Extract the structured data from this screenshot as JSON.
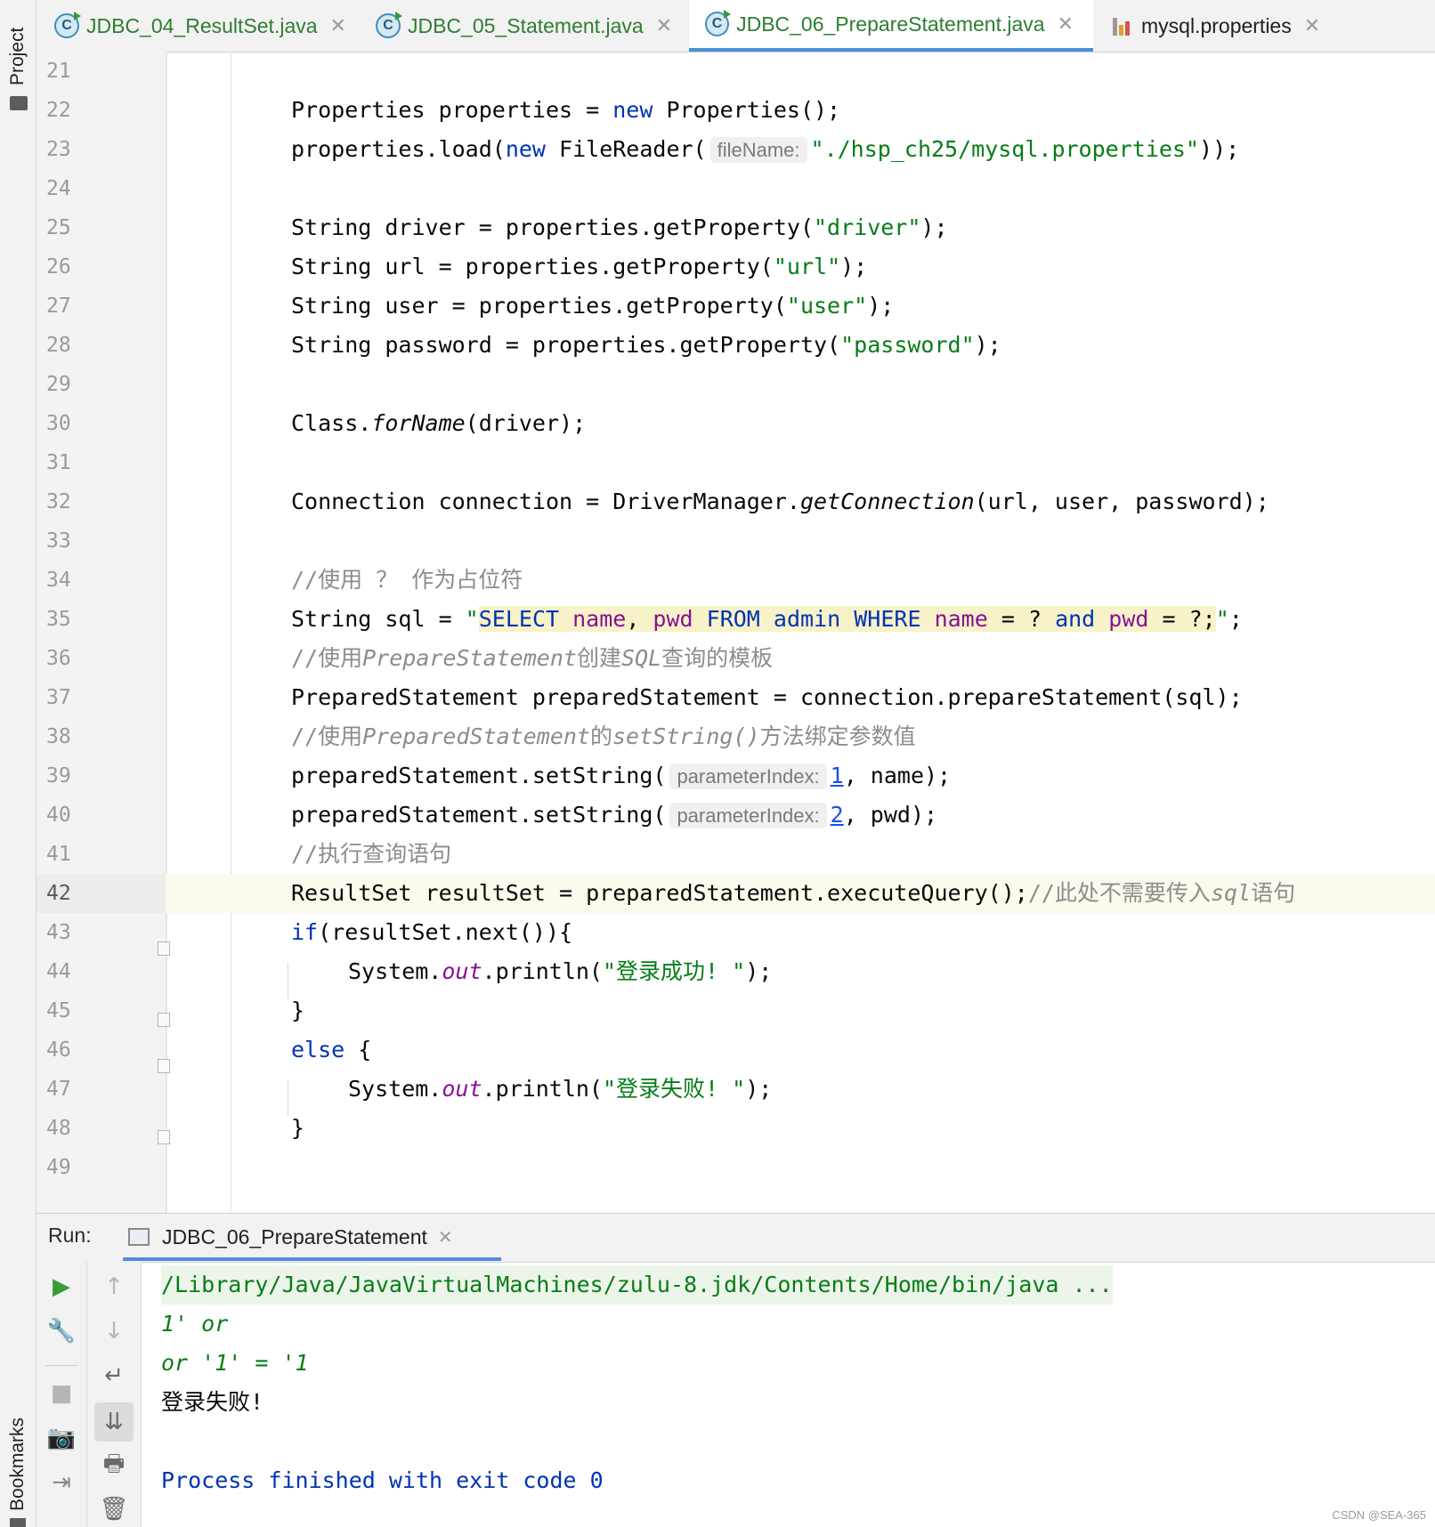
{
  "sidebar": {
    "project_label": "Project",
    "bookmarks_label": "Bookmarks"
  },
  "tabs": [
    {
      "label": "JDBC_04_ResultSet.java",
      "icon": "java-class-icon",
      "active": false
    },
    {
      "label": "JDBC_05_Statement.java",
      "icon": "java-class-icon",
      "active": false
    },
    {
      "label": "JDBC_06_PrepareStatement.java",
      "icon": "java-class-icon",
      "active": true
    },
    {
      "label": "mysql.properties",
      "icon": "properties-file-icon",
      "active": false
    }
  ],
  "editor": {
    "line_numbers": [
      "21",
      "22",
      "23",
      "24",
      "25",
      "26",
      "27",
      "28",
      "29",
      "30",
      "31",
      "32",
      "33",
      "34",
      "35",
      "36",
      "37",
      "38",
      "39",
      "40",
      "41",
      "42",
      "43",
      "44",
      "45",
      "46",
      "47",
      "48",
      "49"
    ],
    "current_line": "42",
    "hints": {
      "file_name": "fileName:",
      "parameter_index": "parameterIndex:"
    },
    "lines": {
      "l22": {
        "t1": "Properties properties = ",
        "kw": "new",
        "t2": " Properties();"
      },
      "l23": {
        "t1": "properties.load(",
        "kw": "new",
        "t2": " FileReader(",
        "s": "\"./hsp_ch25/mysql.properties\"",
        "t3": "));"
      },
      "l25": {
        "t1": "String driver = properties.getProperty(",
        "s": "\"driver\"",
        "t2": ");"
      },
      "l26": {
        "t1": "String url = properties.getProperty(",
        "s": "\"url\"",
        "t2": ");"
      },
      "l27": {
        "t1": "String user = properties.getProperty(",
        "s": "\"user\"",
        "t2": ");"
      },
      "l28": {
        "t1": "String password = properties.getProperty(",
        "s": "\"password\"",
        "t2": ");"
      },
      "l30": {
        "t1": "Class.",
        "it": "forName",
        "t2": "(driver);"
      },
      "l32": {
        "t1": "Connection connection = DriverManager.",
        "it": "getConnection",
        "t2": "(url, user, password);"
      },
      "l34": {
        "c": "//使用 ？ 作为占位符"
      },
      "l35": {
        "t1": "String sql = ",
        "q1": "\"",
        "k1": "SELECT",
        "i1": " name",
        "p1": ", ",
        "i2": "pwd",
        "sp1": " ",
        "k2": "FROM",
        "sp2": " ",
        "k3": "admin",
        "sp3": " ",
        "k4": "WHERE",
        "sp4": " ",
        "i3": "name",
        "p2": " = ? ",
        "k5": "and",
        "sp5": " ",
        "i4": "pwd",
        "p3": " = ?;",
        "q2": "\"",
        "t2": ";"
      },
      "l36": {
        "c1": "//使用",
        "ci1": "PrepareStatement",
        "c2": "创建",
        "ci2": "SQL",
        "c3": "查询的模板"
      },
      "l37": {
        "t1": "PreparedStatement preparedStatement = connection.prepareStatement(sql);"
      },
      "l38": {
        "c1": "//使用",
        "ci1": "PreparedStatement",
        "c2": "的",
        "ci2": "setString()",
        "c3": "方法绑定参数值"
      },
      "l39": {
        "t1": "preparedStatement.setString(",
        "n": "1",
        "t2": ", name);"
      },
      "l40": {
        "t1": "preparedStatement.setString(",
        "n": "2",
        "t2": ", pwd);"
      },
      "l41": {
        "c": "//执行查询语句"
      },
      "l42": {
        "t1": "ResultSet resultSet = preparedStatement.executeQuery();",
        "c1": "//此处不需要传入",
        "ci1": "sql",
        "c2": "语句"
      },
      "l43": {
        "kw": "if",
        "t1": "(resultSet.next()){"
      },
      "l44": {
        "t1": "System.",
        "f": "out",
        "t2": ".println(",
        "s": "\"登录成功! \"",
        "t3": ");"
      },
      "l45": {
        "t1": "}"
      },
      "l46": {
        "kw": "else",
        "t1": " {"
      },
      "l47": {
        "t1": "System.",
        "f": "out",
        "t2": ".println(",
        "s": "\"登录失败! \"",
        "t3": ");"
      },
      "l48": {
        "t1": "}"
      }
    }
  },
  "run": {
    "label": "Run:",
    "tab_label": "JDBC_06_PrepareStatement",
    "console": [
      {
        "text": "/Library/Java/JavaVirtualMachines/zulu-8.jdk/Contents/Home/bin/java ...",
        "color": "#067d17"
      },
      {
        "text": "1' or",
        "color": "#067d17"
      },
      {
        "text": "or '1' = '1",
        "color": "#067d17"
      },
      {
        "text": "登录失败!",
        "color": "#080808"
      },
      {
        "text": "",
        "color": "#080808"
      },
      {
        "text": "Process finished with exit code 0",
        "color": "#0033b3"
      }
    ]
  },
  "colors": {
    "keyword": "#0033b3",
    "string": "#067d17",
    "comment": "#8c8c8c",
    "field": "#871094",
    "accent": "#4a8fd6"
  },
  "watermark": "CSDN @SEA-365"
}
